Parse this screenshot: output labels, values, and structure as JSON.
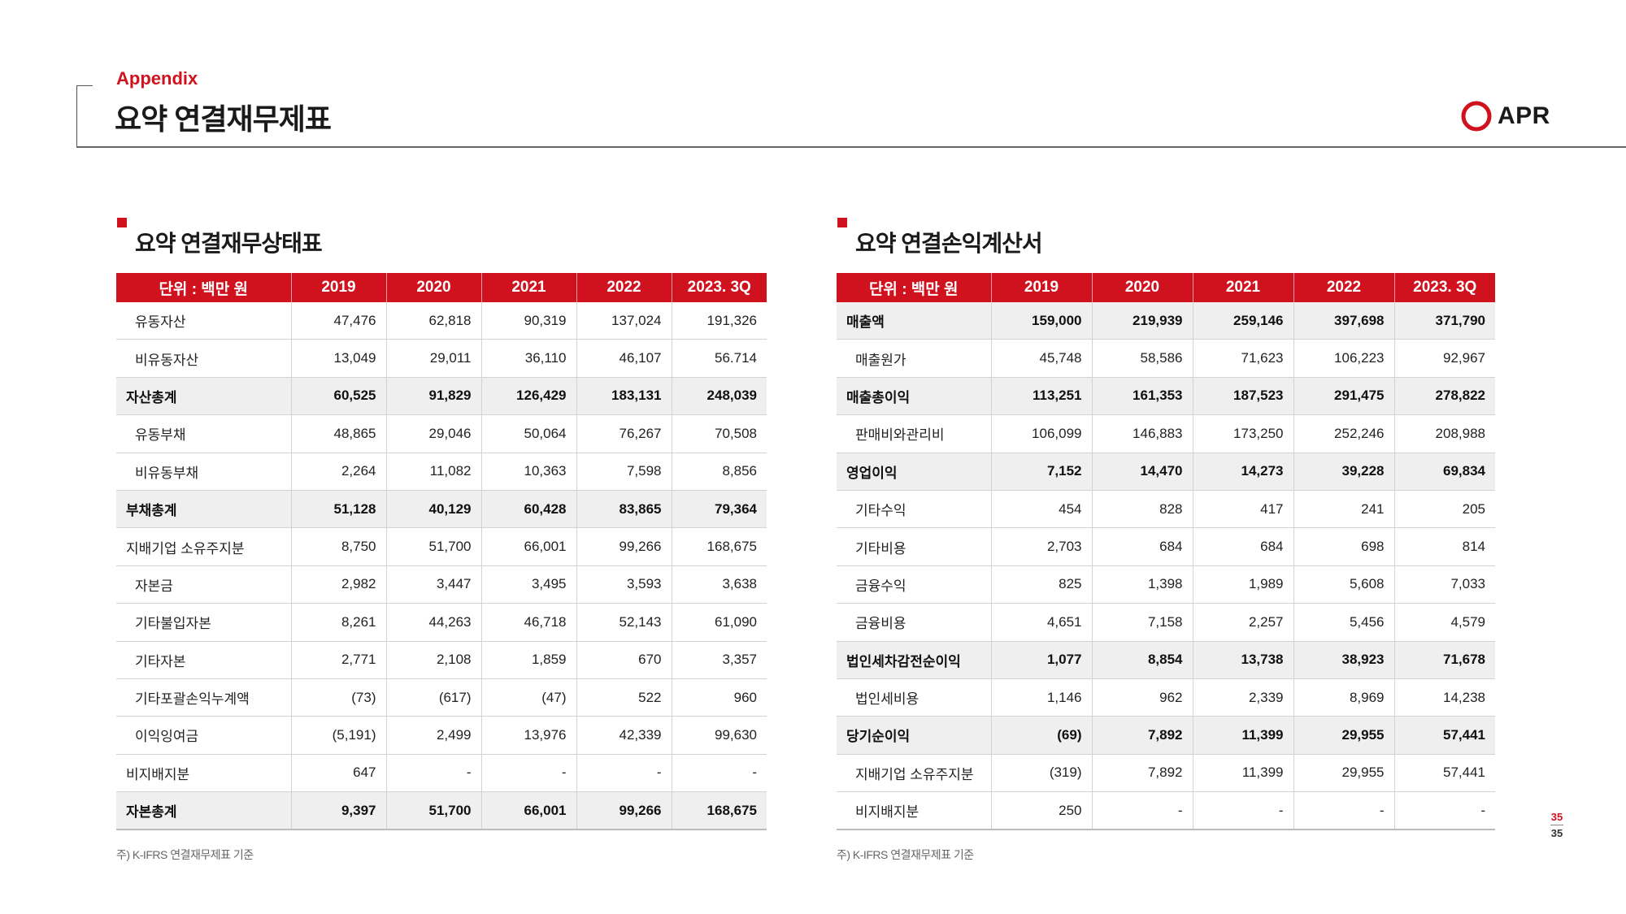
{
  "header": {
    "section_label": "Appendix",
    "title": "요약 연결재무제표",
    "logo_text": "APR",
    "brand_color": "#d0121f"
  },
  "balance_sheet": {
    "title": "요약 연결재무상태표",
    "columns": [
      "단위 : 백만 원",
      "2019",
      "2020",
      "2021",
      "2022",
      "2023. 3Q"
    ],
    "rows": [
      {
        "label": "유동자산",
        "values": [
          "47,476",
          "62,818",
          "90,319",
          "137,024",
          "191,326"
        ]
      },
      {
        "label": "비유동자산",
        "values": [
          "13,049",
          "29,011",
          "36,110",
          "46,107",
          "56.714"
        ]
      },
      {
        "label": "자산총계",
        "values": [
          "60,525",
          "91,829",
          "126,429",
          "183,131",
          "248,039"
        ]
      },
      {
        "label": "유동부채",
        "values": [
          "48,865",
          "29,046",
          "50,064",
          "76,267",
          "70,508"
        ]
      },
      {
        "label": "비유동부채",
        "values": [
          "2,264",
          "11,082",
          "10,363",
          "7,598",
          "8,856"
        ]
      },
      {
        "label": "부채총계",
        "values": [
          "51,128",
          "40,129",
          "60,428",
          "83,865",
          "79,364"
        ]
      },
      {
        "label": "지배기업 소유주지분",
        "values": [
          "8,750",
          "51,700",
          "66,001",
          "99,266",
          "168,675"
        ]
      },
      {
        "label": "자본금",
        "values": [
          "2,982",
          "3,447",
          "3,495",
          "3,593",
          "3,638"
        ]
      },
      {
        "label": "기타불입자본",
        "values": [
          "8,261",
          "44,263",
          "46,718",
          "52,143",
          "61,090"
        ]
      },
      {
        "label": "기타자본",
        "values": [
          "2,771",
          "2,108",
          "1,859",
          "670",
          "3,357"
        ]
      },
      {
        "label": "기타포괄손익누계액",
        "values": [
          "(73)",
          "(617)",
          "(47)",
          "522",
          "960"
        ]
      },
      {
        "label": "이익잉여금",
        "values": [
          "(5,191)",
          "2,499",
          "13,976",
          "42,339",
          "99,630"
        ]
      },
      {
        "label": "비지배지분",
        "values": [
          "647",
          "-",
          "-",
          "-",
          "-"
        ]
      },
      {
        "label": "자본총계",
        "values": [
          "9,397",
          "51,700",
          "66,001",
          "99,266",
          "168,675"
        ]
      }
    ],
    "footnote": "주) K-IFRS 연결재무제표 기준"
  },
  "income_statement": {
    "title": "요약 연결손익계산서",
    "columns": [
      "단위 : 백만 원",
      "2019",
      "2020",
      "2021",
      "2022",
      "2023. 3Q"
    ],
    "rows": [
      {
        "label": "매출액",
        "values": [
          "159,000",
          "219,939",
          "259,146",
          "397,698",
          "371,790"
        ]
      },
      {
        "label": "매출원가",
        "values": [
          "45,748",
          "58,586",
          "71,623",
          "106,223",
          "92,967"
        ]
      },
      {
        "label": "매출총이익",
        "values": [
          "113,251",
          "161,353",
          "187,523",
          "291,475",
          "278,822"
        ]
      },
      {
        "label": "판매비와관리비",
        "values": [
          "106,099",
          "146,883",
          "173,250",
          "252,246",
          "208,988"
        ]
      },
      {
        "label": "영업이익",
        "values": [
          "7,152",
          "14,470",
          "14,273",
          "39,228",
          "69,834"
        ]
      },
      {
        "label": "기타수익",
        "values": [
          "454",
          "828",
          "417",
          "241",
          "205"
        ]
      },
      {
        "label": "기타비용",
        "values": [
          "2,703",
          "684",
          "684",
          "698",
          "814"
        ]
      },
      {
        "label": "금융수익",
        "values": [
          "825",
          "1,398",
          "1,989",
          "5,608",
          "7,033"
        ]
      },
      {
        "label": "금융비용",
        "values": [
          "4,651",
          "7,158",
          "2,257",
          "5,456",
          "4,579"
        ]
      },
      {
        "label": "법인세차감전순이익",
        "values": [
          "1,077",
          "8,854",
          "13,738",
          "38,923",
          "71,678"
        ]
      },
      {
        "label": "법인세비용",
        "values": [
          "1,146",
          "962",
          "2,339",
          "8,969",
          "14,238"
        ]
      },
      {
        "label": "당기순이익",
        "values": [
          "(69)",
          "7,892",
          "11,399",
          "29,955",
          "57,441"
        ]
      },
      {
        "label": "지배기업 소유주지분",
        "values": [
          "(319)",
          "7,892",
          "11,399",
          "29,955",
          "57,441"
        ]
      },
      {
        "label": "비지배지분",
        "values": [
          "250",
          "-",
          "-",
          "-",
          "-"
        ]
      }
    ],
    "footnote": "주) K-IFRS 연결재무제표 기준"
  },
  "page": {
    "current": "35",
    "total": "35"
  }
}
